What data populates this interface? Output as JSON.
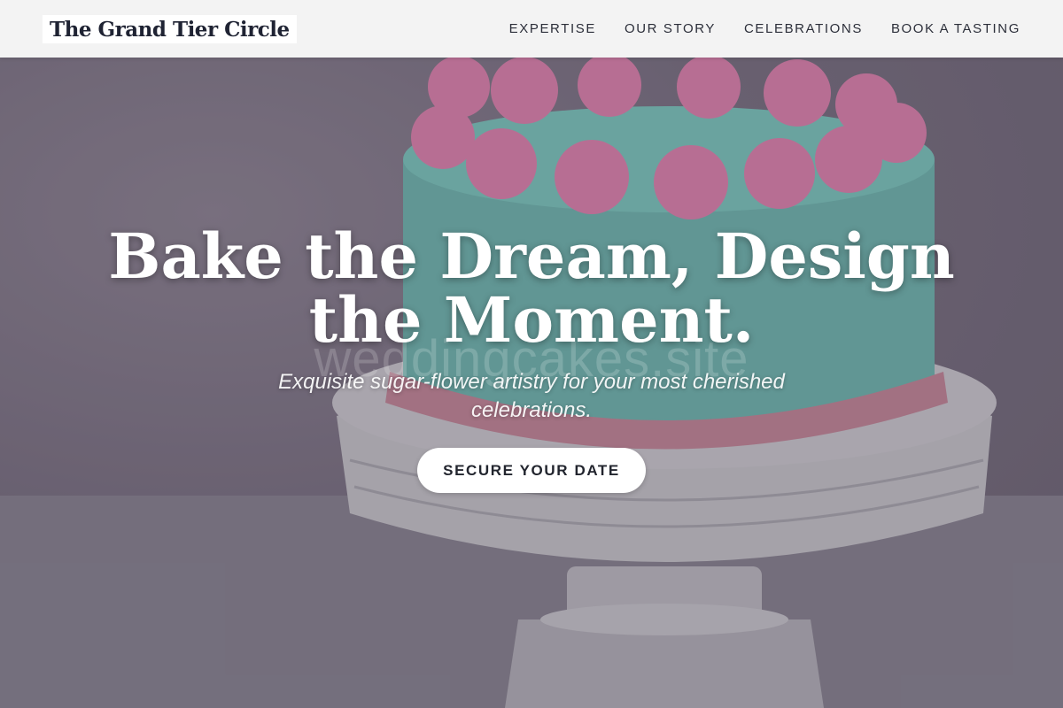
{
  "brand": {
    "name": "The Grand Tier Circle"
  },
  "nav": {
    "items": [
      {
        "label": "EXPERTISE"
      },
      {
        "label": "OUR STORY"
      },
      {
        "label": "CELEBRATIONS"
      },
      {
        "label": "BOOK A TASTING"
      }
    ]
  },
  "hero": {
    "headline": "Bake the Dream, Design the Moment.",
    "subheadline": "Exquisite sugar-flower artistry for your most cherished celebrations.",
    "cta_label": "SECURE YOUR DATE",
    "watermark": "weddingcakes.site",
    "image_description_icon": "cake-photo"
  },
  "colors": {
    "header_bg": "#f3f3f3",
    "brand_text": "#1f2333",
    "nav_text": "#2c2f3a",
    "cake_teal": "#7ccfc4",
    "frosting_pink": "#f07fb0",
    "stand_white": "#e9e9ec",
    "cta_bg": "#ffffff",
    "cta_text": "#22252e"
  }
}
